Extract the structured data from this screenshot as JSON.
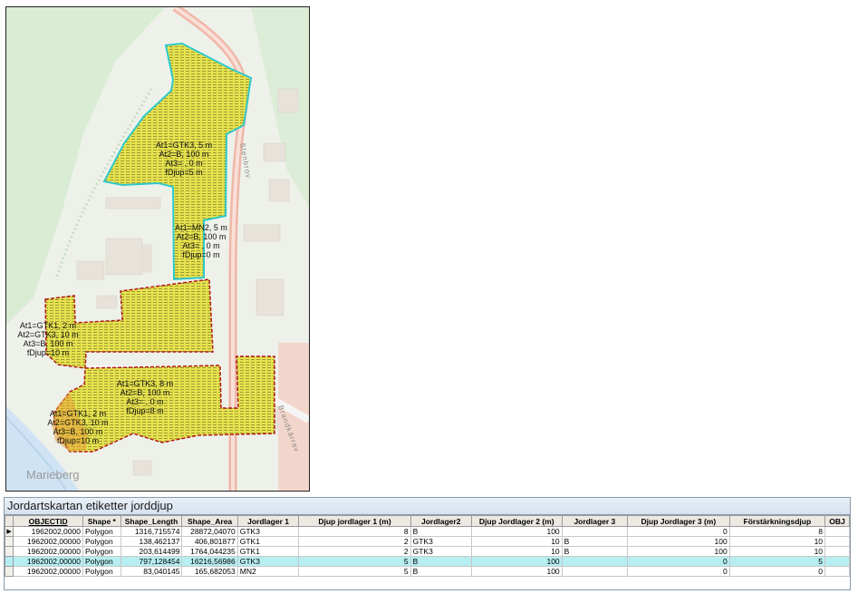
{
  "map": {
    "street_1": "Stenbrov",
    "street_2": "Brandkärrav",
    "place": "Marieberg",
    "labels": [
      [
        "At1=GTK3, 5 m",
        "At2=B, 100 m",
        "At3= , 0 m",
        "fDjup=5 m"
      ],
      [
        "At1=MN2, 5 m",
        "At2=B, 100 m",
        "At3= , 0 m",
        "fDjup=0 m"
      ],
      [
        "At1=GTK1, 2 m",
        "At2=GTK3, 10 m",
        "At3=B, 100 m",
        "fDjup=10 m"
      ],
      [
        "At1=GTK3, 8 m",
        "At2=B, 100 m",
        "At3= , 0 m",
        "fDjup=8 m"
      ],
      [
        "At1=GTK1, 2 m",
        "At2=GTK3, 10 m",
        "At3=B, 100 m",
        "fDjup=10 m"
      ]
    ],
    "colors": {
      "fill": "#e5e04a",
      "outline_red": "#b01818",
      "outline_cyan": "#2fc9c9",
      "road": "#efb7a8"
    }
  },
  "table": {
    "title": "Jordartskartan etiketter jorddjup",
    "columns": [
      "OBJECTID",
      "Shape *",
      "Shape_Length",
      "Shape_Area",
      "Jordlager 1",
      "Djup jordlager 1 (m)",
      "Jordlager2",
      "Djup Jordlager 2 (m)",
      "Jordlager 3",
      "Djup Jordlager 3 (m)",
      "Förstärkningsdjup",
      "OBJ"
    ],
    "rows": [
      [
        "1962002,0000",
        "Polygon",
        "1316,715574",
        "28872,04070",
        "GTK3",
        "8",
        "B",
        "100",
        "",
        "0",
        "8",
        ""
      ],
      [
        "1962002,00000",
        "Polygon",
        "138,462137",
        "406,801877",
        "GTK1",
        "2",
        "GTK3",
        "10",
        "B",
        "100",
        "10",
        ""
      ],
      [
        "1962002,00000",
        "Polygon",
        "203,614499",
        "1764,044235",
        "GTK1",
        "2",
        "GTK3",
        "10",
        "B",
        "100",
        "10",
        ""
      ],
      [
        "1962002,00000",
        "Polygon",
        "797,128454",
        "16216,56986",
        "GTK3",
        "5",
        "B",
        "100",
        "",
        "0",
        "5",
        ""
      ],
      [
        "1962002,00000",
        "Polygon",
        "83,040145",
        "165,682053",
        "MN2",
        "5",
        "B",
        "100",
        "",
        "0",
        "0",
        ""
      ]
    ],
    "selected_row": 0,
    "highlighted_row": 3
  }
}
